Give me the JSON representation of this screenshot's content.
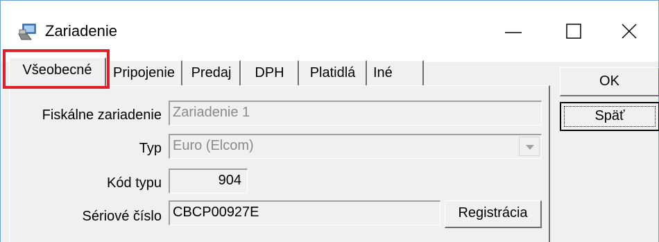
{
  "window": {
    "title": "Zariadenie"
  },
  "tabs": [
    {
      "label": "Všeobecné",
      "active": true
    },
    {
      "label": "Pripojenie",
      "active": false
    },
    {
      "label": "Predaj",
      "active": false
    },
    {
      "label": "DPH",
      "active": false
    },
    {
      "label": "Platidlá",
      "active": false
    },
    {
      "label": "Iné",
      "active": false
    }
  ],
  "form": {
    "fiscal_device_label": "Fiskálne zariadenie",
    "fiscal_device_value": "Zariadenie 1",
    "type_label": "Typ",
    "type_value": "Euro (Elcom)",
    "type_code_label": "Kód typu",
    "type_code_value": "904",
    "serial_label": "Sériové číslo",
    "serial_value": "CBCP00927E",
    "registration_button": "Registrácia"
  },
  "buttons": {
    "ok": "OK",
    "back": "Späť"
  },
  "colors": {
    "highlight": "#e01f26",
    "window_border": "#6f9fd8"
  }
}
